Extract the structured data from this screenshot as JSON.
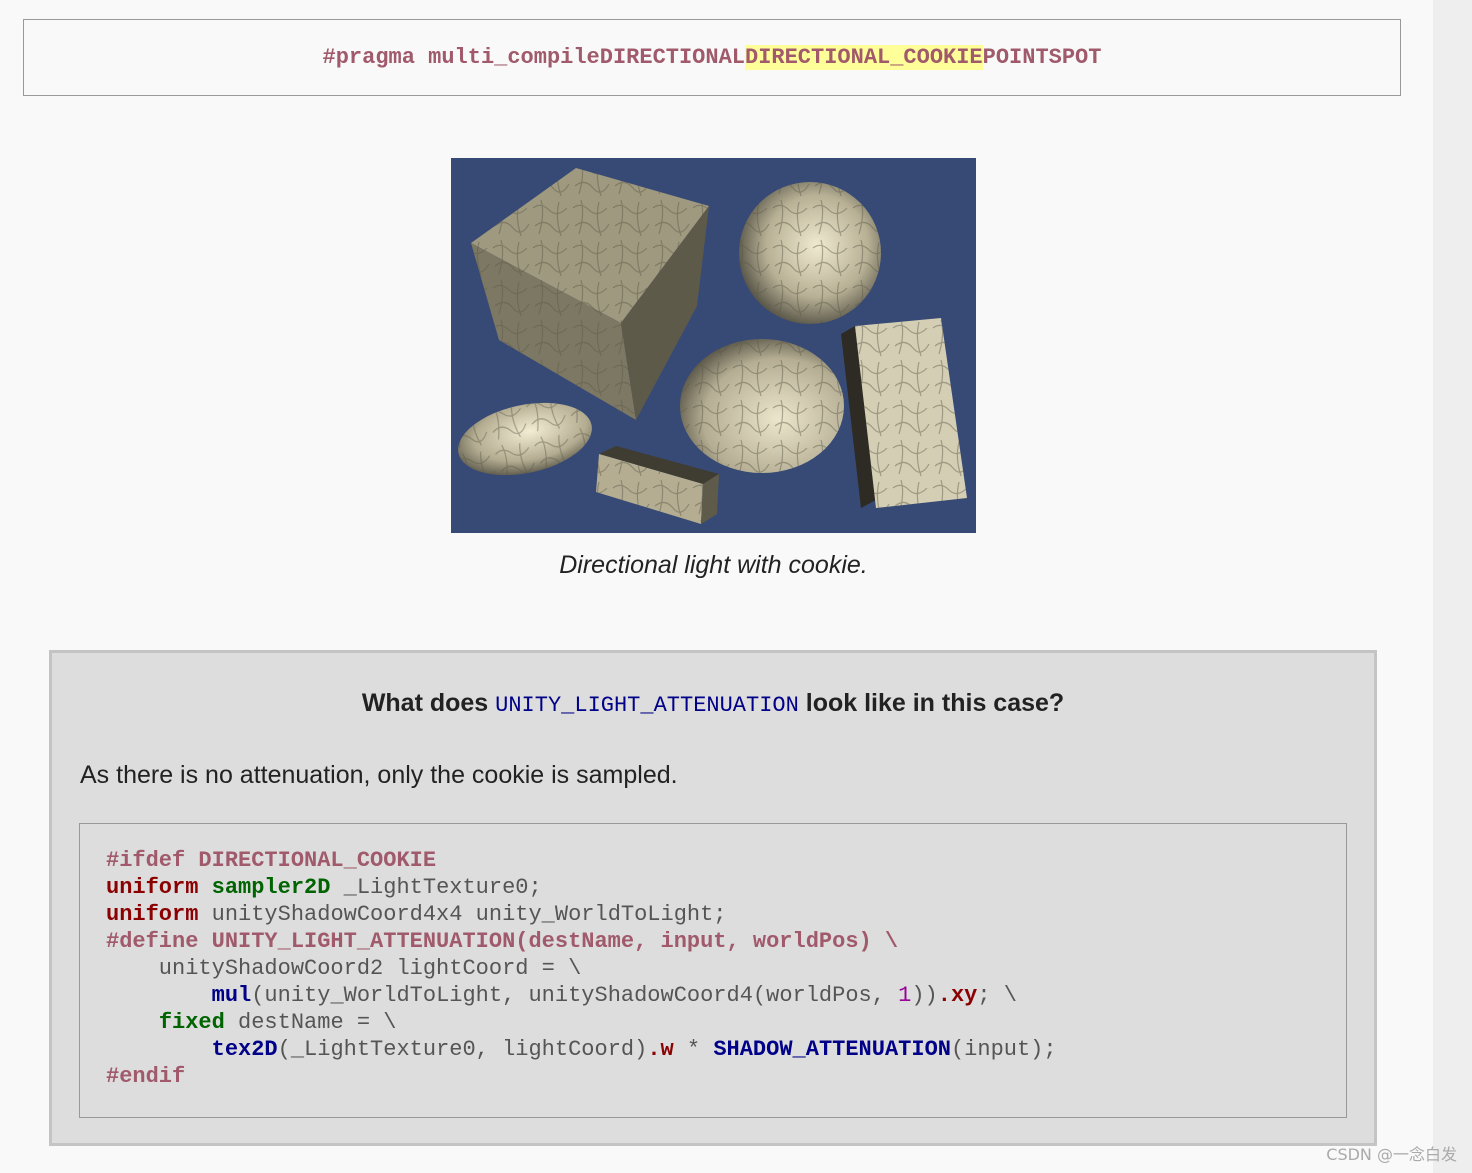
{
  "top_code": {
    "directive": "#pragma multi_compile",
    "keywords": [
      "DIRECTIONAL",
      "DIRECTIONAL_COOKIE",
      "POINT",
      "SPOT"
    ],
    "highlighted": "DIRECTIONAL_COOKIE"
  },
  "figure": {
    "caption": "Directional light with cookie.",
    "colors": {
      "background": "#374a75",
      "stone_light": "#d8d3b8",
      "stone_dark": "#6f6a58"
    }
  },
  "info_box": {
    "heading_before": "What does ",
    "heading_keyword": "UNITY_LIGHT_ATTENUATION",
    "heading_after": " look like in this case?",
    "paragraph": "As there is no attenuation, only the cookie is sampled.",
    "code": {
      "l1_pp": "#ifdef DIRECTIONAL_COOKIE",
      "l2_kw": "uniform",
      "l2_type": "sampler2D",
      "l2_rest": " _LightTexture0;",
      "l3_kw": "uniform",
      "l3_rest": " unityShadowCoord4x4 unity_WorldToLight;",
      "l4_pp": "#define UNITY_LIGHT_ATTENUATION(destName, input, worldPos) \\",
      "l5": "    unityShadowCoord2 lightCoord = \\",
      "l6_indent": "        ",
      "l6_fn": "mul",
      "l6_mid": "(unity_WorldToLight, unityShadowCoord4(worldPos, ",
      "l6_num": "1",
      "l6_close": "))",
      "l6_dot": ".",
      "l6_mem": "xy",
      "l6_end": "; \\",
      "l7_indent": "    ",
      "l7_type": "fixed",
      "l7_rest": " destName = \\",
      "l8_indent": "        ",
      "l8_fn": "tex2D",
      "l8_mid": "(_LightTexture0, lightCoord)",
      "l8_dot": ".",
      "l8_mem": "w",
      "l8_op": " * ",
      "l8_fn2": "SHADOW_ATTENUATION",
      "l8_end": "(input);",
      "l9_pp": "#endif"
    }
  },
  "watermark": "CSDN @一念白发"
}
